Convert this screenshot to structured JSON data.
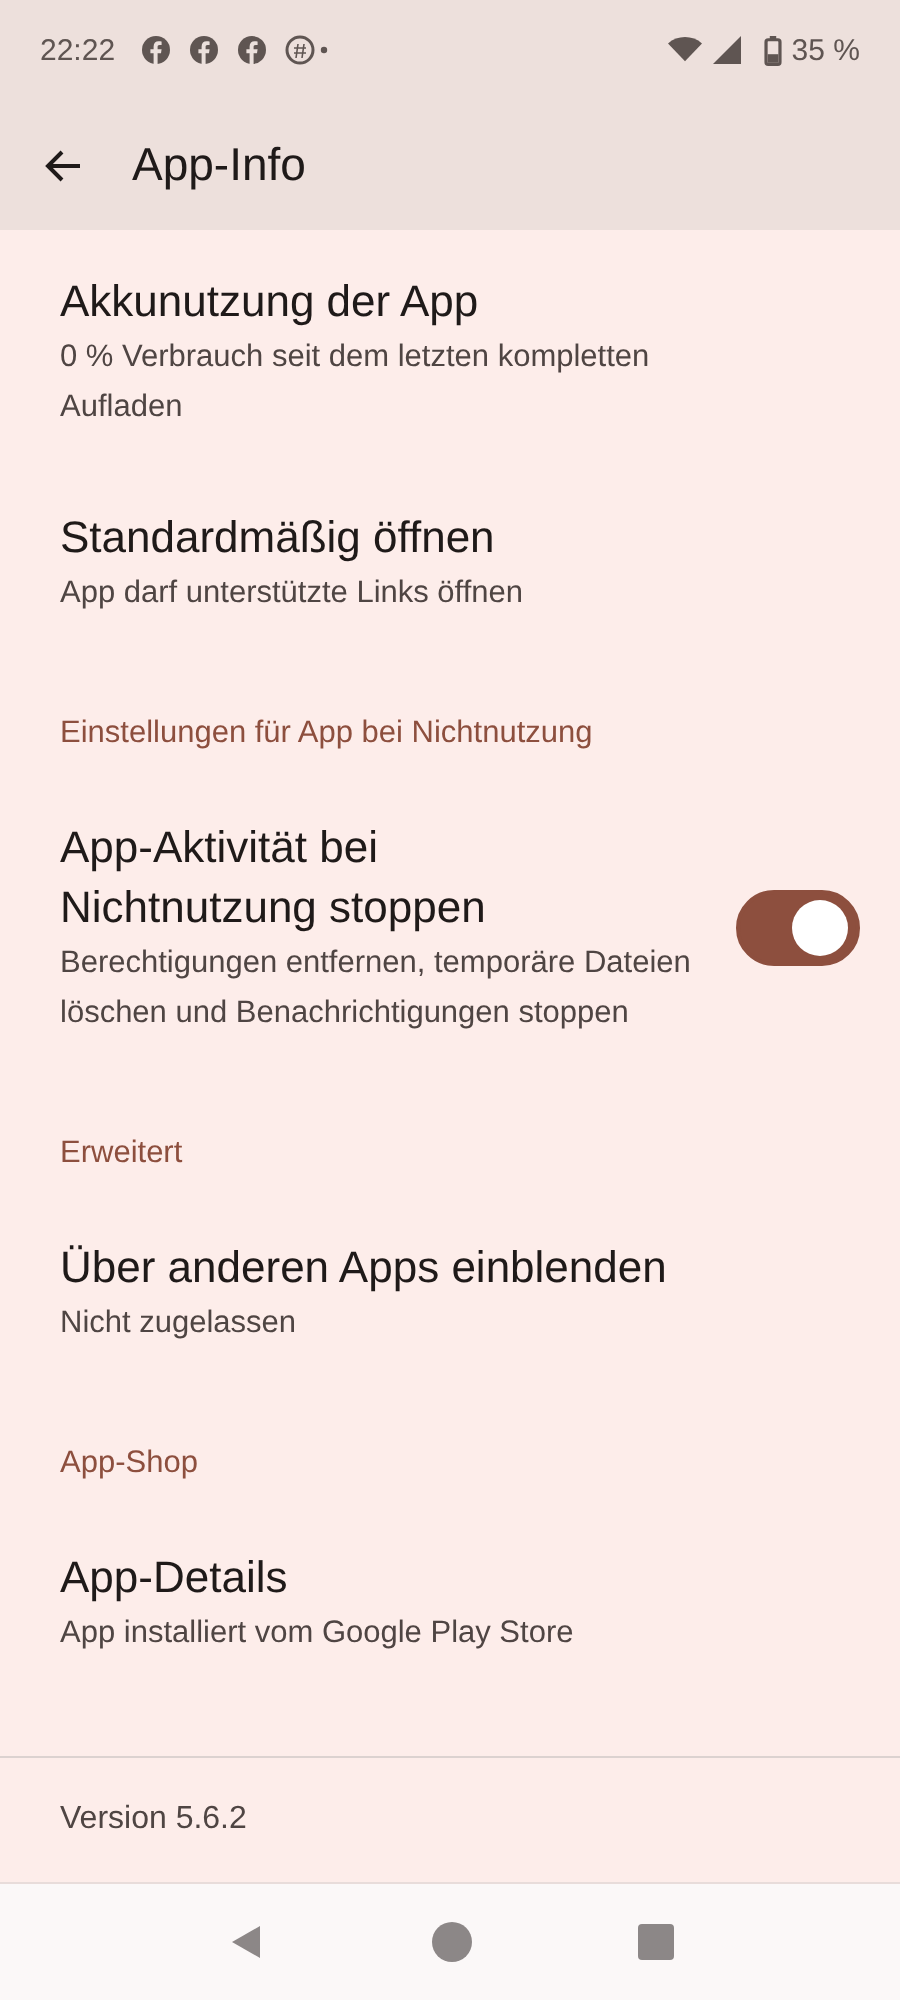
{
  "status_bar": {
    "time": "22:22",
    "battery": "35 %"
  },
  "app_bar": {
    "title": "App-Info"
  },
  "items": [
    {
      "kind": "setting",
      "title": "Akkunutzung der App",
      "summary": "0 % Verbrauch seit dem letzten kompletten Aufladen"
    },
    {
      "kind": "setting",
      "title": "Standardmäßig öffnen",
      "summary": "App darf unterstützte Links öffnen"
    },
    {
      "kind": "header",
      "title": "Einstellungen für App bei Nichtnutzung"
    },
    {
      "kind": "switch",
      "title": "App-Aktivität bei Nichtnutzung stoppen",
      "summary": "Berechtigungen entfernen, temporäre Dateien löschen und Benachrichtigungen stoppen",
      "on": true
    },
    {
      "kind": "header",
      "title": "Erweitert"
    },
    {
      "kind": "setting",
      "title": "Über anderen Apps einblenden",
      "summary": "Nicht zugelassen"
    },
    {
      "kind": "header",
      "title": "App-Shop"
    },
    {
      "kind": "setting",
      "title": "App-Details",
      "summary": "App installiert vom Google Play Store"
    }
  ],
  "footer": {
    "version": "Version 5.6.2"
  }
}
